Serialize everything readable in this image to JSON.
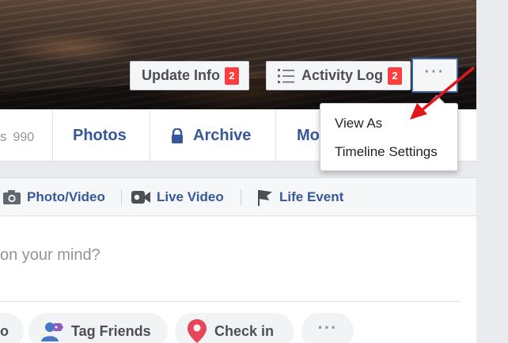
{
  "cover": {
    "update_info": {
      "label": "Update Info",
      "badge": "2"
    },
    "activity_log": {
      "label": "Activity Log",
      "badge": "2",
      "icon": "list-icon"
    },
    "more": {
      "label": "···",
      "icon": "more-horizontal-icon"
    }
  },
  "nav": {
    "friends_tail": "s",
    "friends_count": "990",
    "photos": "Photos",
    "archive": "Archive",
    "more_partial": "Mo"
  },
  "dropdown": {
    "items": [
      "View As",
      "Timeline Settings"
    ]
  },
  "composer": {
    "tools": [
      "Photo/Video",
      "Live Video",
      "Life Event"
    ],
    "placeholder": "on your mind?",
    "actions": [
      "o",
      "Tag Friends",
      "Check in"
    ]
  },
  "colors": {
    "link_blue": "#365899",
    "badge_red": "#fa3e3e",
    "focus_blue": "#4267b2",
    "annotation_arrow": "#e3161b"
  }
}
